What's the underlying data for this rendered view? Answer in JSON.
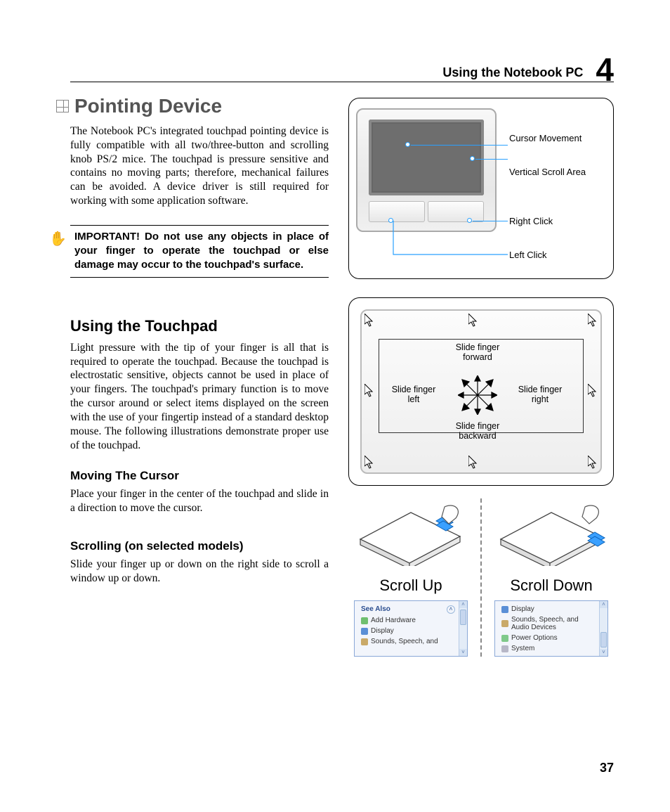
{
  "header": {
    "title": "Using the Notebook PC",
    "chapter_number": "4"
  },
  "section": {
    "title": "Pointing Device",
    "intro": "The Notebook PC's integrated touchpad pointing device is fully compatible with all two/three-button and scrolling knob PS/2 mice. The touchpad is pressure sensitive and contains no moving parts; therefore, mechanical failures can be avoided. A device driver is still required for working with some application software."
  },
  "important": "IMPORTANT! Do not use any objects in place of your finger to operate the touchpad or else damage may occur to the touchpad's surface.",
  "using": {
    "heading": "Using the Touchpad",
    "body": "Light pressure with the tip of your finger is all that is required to operate the touchpad. Because the touchpad is electrostatic sensitive, objects cannot be used in place of your fingers. The touchpad's primary function is to move the cursor around or select items displayed on the screen with the use of your fingertip instead of a standard desktop mouse. The following illustrations demonstrate proper use of the touchpad."
  },
  "moving": {
    "heading": "Moving The Cursor",
    "body": "Place your finger in the center of the touchpad and slide in a direction to move the cursor."
  },
  "scrolling": {
    "heading": "Scrolling (on selected models)",
    "body": "Slide your finger up or down on the right side to scroll a window up or down."
  },
  "figure1": {
    "cursor_movement": "Cursor Movement",
    "vertical_scroll": "Vertical Scroll Area",
    "right_click": "Right Click",
    "left_click": "Left Click"
  },
  "figure2": {
    "forward": "Slide finger forward",
    "left": "Slide finger left",
    "right": "Slide finger right",
    "backward": "Slide finger backward"
  },
  "scroll_fig": {
    "up": "Scroll Up",
    "down": "Scroll Down",
    "panel_up": {
      "header": "See Also",
      "items": [
        "Add Hardware",
        "Display",
        "Sounds, Speech, and"
      ]
    },
    "panel_down": {
      "items": [
        "Display",
        "Sounds, Speech, and Audio Devices",
        "Power Options",
        "System"
      ]
    }
  },
  "page_number": "37"
}
